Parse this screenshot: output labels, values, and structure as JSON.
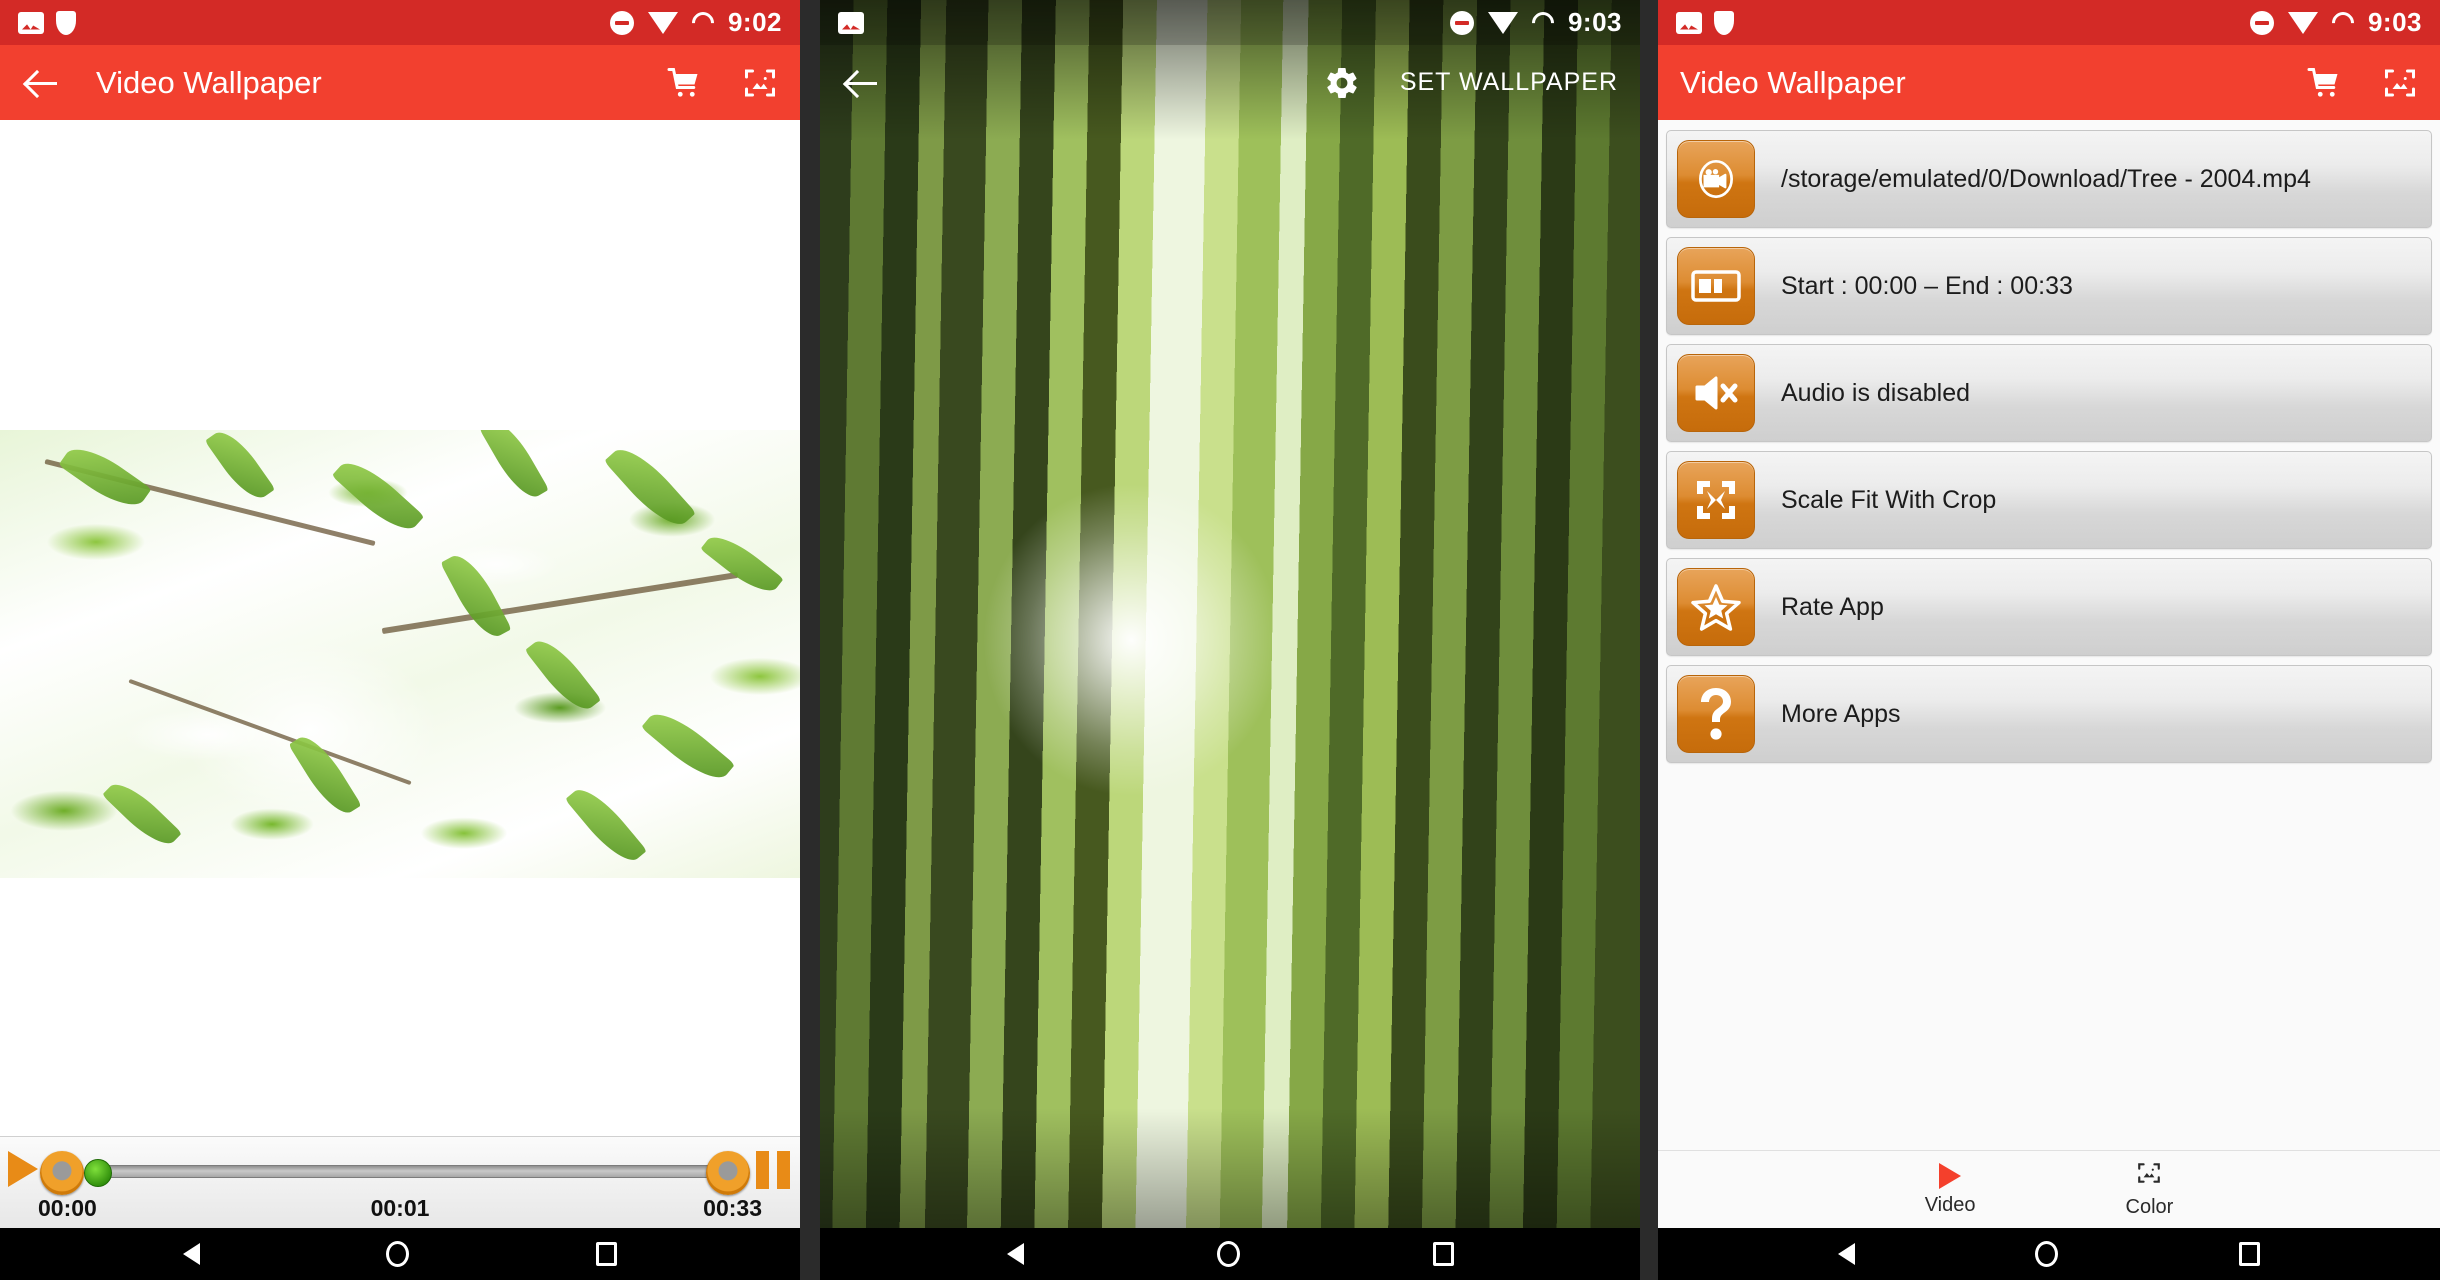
{
  "app": {
    "name": "Video Wallpaper",
    "accent_red": "#f2402f",
    "accent_orange": "#d9830f"
  },
  "panel1": {
    "status": {
      "time": "9:02",
      "icons": [
        "photo-icon",
        "shield-icon",
        "do-not-disturb-icon",
        "wifi-icon",
        "battery-icon"
      ]
    },
    "appbar": {
      "title": "Video Wallpaper",
      "back": "back-arrow-icon",
      "cart": "cart-icon",
      "crop": "crop-image-icon"
    },
    "player": {
      "start_time": "00:00",
      "current_time": "00:01",
      "end_time": "00:33",
      "play_icon": "play-icon",
      "pause_icon": "pause-icon",
      "start_handle": "trim-start-handle",
      "end_handle": "trim-end-handle",
      "position_handle": "playhead-handle"
    }
  },
  "panel2": {
    "status": {
      "time": "9:03",
      "icons": [
        "photo-icon",
        "do-not-disturb-icon",
        "wifi-icon",
        "battery-icon"
      ]
    },
    "appbar": {
      "back": "back-arrow-icon",
      "settings_icon": "gear-icon",
      "set_wallpaper": "SET WALLPAPER"
    }
  },
  "panel3": {
    "status": {
      "time": "9:03",
      "icons": [
        "photo-icon",
        "shield-icon",
        "do-not-disturb-icon",
        "wifi-icon",
        "battery-icon"
      ]
    },
    "appbar": {
      "title": "Video Wallpaper",
      "cart": "cart-icon",
      "crop": "crop-image-icon"
    },
    "options": [
      {
        "icon": "video-camera-icon",
        "label": "/storage/emulated/0/Download/Tree - 2004.mp4"
      },
      {
        "icon": "trim-range-icon",
        "label": "Start : 00:00 – End : 00:33"
      },
      {
        "icon": "mute-speaker-icon",
        "label": "Audio is disabled"
      },
      {
        "icon": "scale-expand-icon",
        "label": "Scale Fit With Crop"
      },
      {
        "icon": "star-icon",
        "label": "Rate App"
      },
      {
        "icon": "question-mark-icon",
        "label": "More Apps"
      }
    ],
    "tabs": [
      {
        "icon": "play-icon",
        "label": "Video",
        "selected": true
      },
      {
        "icon": "crop-image-icon",
        "label": "Color",
        "selected": false
      }
    ]
  },
  "navbar": {
    "back": "nav-back-icon",
    "home": "nav-home-icon",
    "recents": "nav-recents-icon"
  }
}
